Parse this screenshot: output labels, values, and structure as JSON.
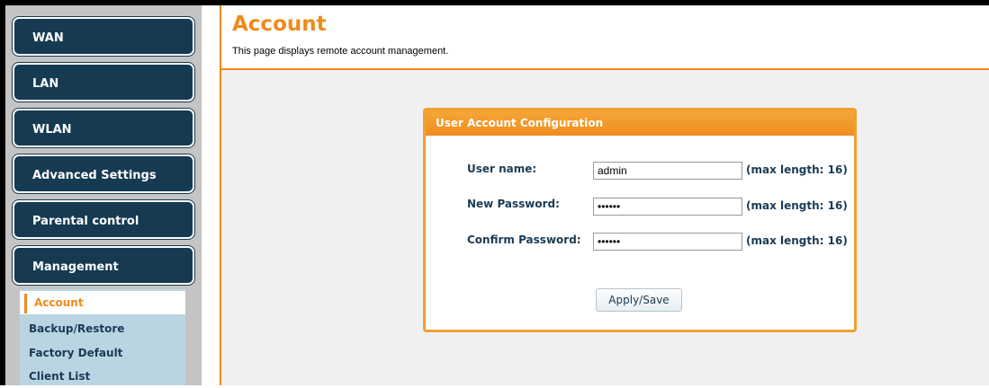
{
  "sidebar": {
    "nav": [
      {
        "label": "WAN"
      },
      {
        "label": "LAN"
      },
      {
        "label": "WLAN"
      },
      {
        "label": "Advanced Settings"
      },
      {
        "label": "Parental control"
      },
      {
        "label": "Management"
      }
    ],
    "management_items": [
      {
        "label": "Account",
        "active": true
      },
      {
        "label": "Backup/Restore"
      },
      {
        "label": "Factory Default"
      },
      {
        "label": "Client List"
      }
    ]
  },
  "header": {
    "title": "Account",
    "description": "This page displays remote account management."
  },
  "form": {
    "title": "User Account Configuration",
    "fields": [
      {
        "label": "User name:",
        "value": "admin",
        "hint": "(max length: 16)"
      },
      {
        "label": "New Password:",
        "value": "••••••",
        "hint": "(max length: 16)"
      },
      {
        "label": "Confirm Password:",
        "value": "••••••",
        "hint": "(max length: 16)"
      }
    ],
    "apply_label": "Apply/Save"
  },
  "colors": {
    "accent": "#ef8a1a",
    "nav_bg": "#163a52",
    "submenu_bg": "#b9d5e2",
    "text_dark": "#1a3b55"
  }
}
